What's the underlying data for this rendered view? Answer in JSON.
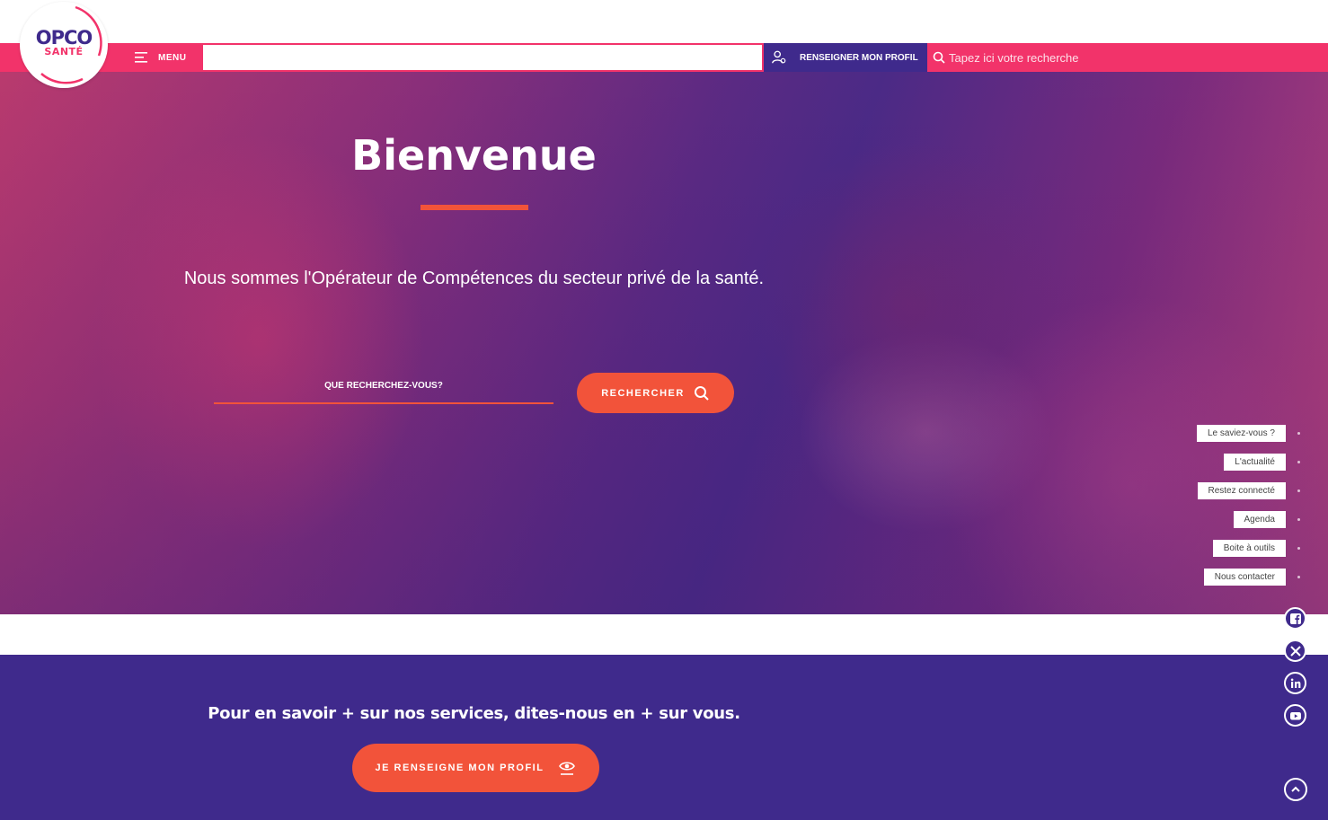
{
  "logo": {
    "line1": "OPCO",
    "line2": "SANTÉ"
  },
  "nav": {
    "menu_label": "MENU",
    "profile_label": "RENSEIGNER MON PROFIL",
    "search_placeholder": "Tapez ici votre recherche"
  },
  "hero": {
    "title": "Bienvenue",
    "subtitle": "Nous sommes l'Opérateur de Compétences du secteur privé de la santé.",
    "search_placeholder": "QUE RECHERCHEZ-VOUS?",
    "search_button": "RECHERCHER"
  },
  "quick_links": [
    {
      "label": "Le saviez-vous ?"
    },
    {
      "label": "L'actualité"
    },
    {
      "label": "Restez connecté"
    },
    {
      "label": "Agenda"
    },
    {
      "label": "Boite à outils"
    },
    {
      "label": "Nous contacter"
    }
  ],
  "social": [
    "facebook-icon",
    "x-icon",
    "linkedin-icon",
    "youtube-icon"
  ],
  "profile_section": {
    "text": "Pour en savoir + sur nos services, dites-nous en + sur vous.",
    "button": "JE RENSEIGNE MON PROFIL"
  },
  "colors": {
    "pink": "#f2336a",
    "orange": "#f2533a",
    "purple": "#3f2a8c"
  }
}
